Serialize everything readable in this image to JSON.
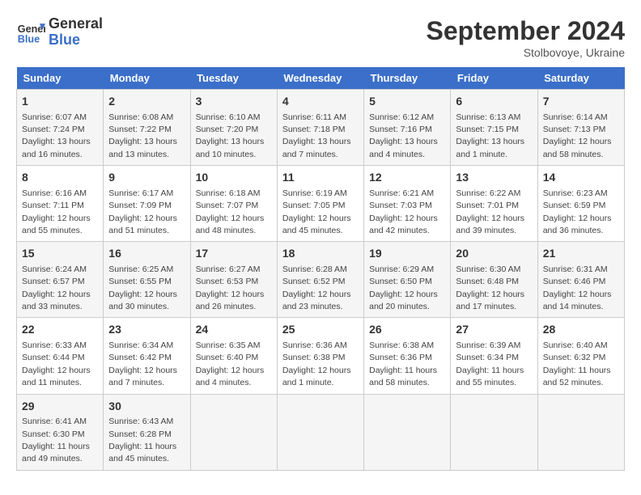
{
  "logo": {
    "line1": "General",
    "line2": "Blue"
  },
  "title": "September 2024",
  "subtitle": "Stolbovoye, Ukraine",
  "weekdays": [
    "Sunday",
    "Monday",
    "Tuesday",
    "Wednesday",
    "Thursday",
    "Friday",
    "Saturday"
  ],
  "weeks": [
    [
      {
        "day": "1",
        "sunrise": "Sunrise: 6:07 AM",
        "sunset": "Sunset: 7:24 PM",
        "daylight": "Daylight: 13 hours and 16 minutes."
      },
      {
        "day": "2",
        "sunrise": "Sunrise: 6:08 AM",
        "sunset": "Sunset: 7:22 PM",
        "daylight": "Daylight: 13 hours and 13 minutes."
      },
      {
        "day": "3",
        "sunrise": "Sunrise: 6:10 AM",
        "sunset": "Sunset: 7:20 PM",
        "daylight": "Daylight: 13 hours and 10 minutes."
      },
      {
        "day": "4",
        "sunrise": "Sunrise: 6:11 AM",
        "sunset": "Sunset: 7:18 PM",
        "daylight": "Daylight: 13 hours and 7 minutes."
      },
      {
        "day": "5",
        "sunrise": "Sunrise: 6:12 AM",
        "sunset": "Sunset: 7:16 PM",
        "daylight": "Daylight: 13 hours and 4 minutes."
      },
      {
        "day": "6",
        "sunrise": "Sunrise: 6:13 AM",
        "sunset": "Sunset: 7:15 PM",
        "daylight": "Daylight: 13 hours and 1 minute."
      },
      {
        "day": "7",
        "sunrise": "Sunrise: 6:14 AM",
        "sunset": "Sunset: 7:13 PM",
        "daylight": "Daylight: 12 hours and 58 minutes."
      }
    ],
    [
      {
        "day": "8",
        "sunrise": "Sunrise: 6:16 AM",
        "sunset": "Sunset: 7:11 PM",
        "daylight": "Daylight: 12 hours and 55 minutes."
      },
      {
        "day": "9",
        "sunrise": "Sunrise: 6:17 AM",
        "sunset": "Sunset: 7:09 PM",
        "daylight": "Daylight: 12 hours and 51 minutes."
      },
      {
        "day": "10",
        "sunrise": "Sunrise: 6:18 AM",
        "sunset": "Sunset: 7:07 PM",
        "daylight": "Daylight: 12 hours and 48 minutes."
      },
      {
        "day": "11",
        "sunrise": "Sunrise: 6:19 AM",
        "sunset": "Sunset: 7:05 PM",
        "daylight": "Daylight: 12 hours and 45 minutes."
      },
      {
        "day": "12",
        "sunrise": "Sunrise: 6:21 AM",
        "sunset": "Sunset: 7:03 PM",
        "daylight": "Daylight: 12 hours and 42 minutes."
      },
      {
        "day": "13",
        "sunrise": "Sunrise: 6:22 AM",
        "sunset": "Sunset: 7:01 PM",
        "daylight": "Daylight: 12 hours and 39 minutes."
      },
      {
        "day": "14",
        "sunrise": "Sunrise: 6:23 AM",
        "sunset": "Sunset: 6:59 PM",
        "daylight": "Daylight: 12 hours and 36 minutes."
      }
    ],
    [
      {
        "day": "15",
        "sunrise": "Sunrise: 6:24 AM",
        "sunset": "Sunset: 6:57 PM",
        "daylight": "Daylight: 12 hours and 33 minutes."
      },
      {
        "day": "16",
        "sunrise": "Sunrise: 6:25 AM",
        "sunset": "Sunset: 6:55 PM",
        "daylight": "Daylight: 12 hours and 30 minutes."
      },
      {
        "day": "17",
        "sunrise": "Sunrise: 6:27 AM",
        "sunset": "Sunset: 6:53 PM",
        "daylight": "Daylight: 12 hours and 26 minutes."
      },
      {
        "day": "18",
        "sunrise": "Sunrise: 6:28 AM",
        "sunset": "Sunset: 6:52 PM",
        "daylight": "Daylight: 12 hours and 23 minutes."
      },
      {
        "day": "19",
        "sunrise": "Sunrise: 6:29 AM",
        "sunset": "Sunset: 6:50 PM",
        "daylight": "Daylight: 12 hours and 20 minutes."
      },
      {
        "day": "20",
        "sunrise": "Sunrise: 6:30 AM",
        "sunset": "Sunset: 6:48 PM",
        "daylight": "Daylight: 12 hours and 17 minutes."
      },
      {
        "day": "21",
        "sunrise": "Sunrise: 6:31 AM",
        "sunset": "Sunset: 6:46 PM",
        "daylight": "Daylight: 12 hours and 14 minutes."
      }
    ],
    [
      {
        "day": "22",
        "sunrise": "Sunrise: 6:33 AM",
        "sunset": "Sunset: 6:44 PM",
        "daylight": "Daylight: 12 hours and 11 minutes."
      },
      {
        "day": "23",
        "sunrise": "Sunrise: 6:34 AM",
        "sunset": "Sunset: 6:42 PM",
        "daylight": "Daylight: 12 hours and 7 minutes."
      },
      {
        "day": "24",
        "sunrise": "Sunrise: 6:35 AM",
        "sunset": "Sunset: 6:40 PM",
        "daylight": "Daylight: 12 hours and 4 minutes."
      },
      {
        "day": "25",
        "sunrise": "Sunrise: 6:36 AM",
        "sunset": "Sunset: 6:38 PM",
        "daylight": "Daylight: 12 hours and 1 minute."
      },
      {
        "day": "26",
        "sunrise": "Sunrise: 6:38 AM",
        "sunset": "Sunset: 6:36 PM",
        "daylight": "Daylight: 11 hours and 58 minutes."
      },
      {
        "day": "27",
        "sunrise": "Sunrise: 6:39 AM",
        "sunset": "Sunset: 6:34 PM",
        "daylight": "Daylight: 11 hours and 55 minutes."
      },
      {
        "day": "28",
        "sunrise": "Sunrise: 6:40 AM",
        "sunset": "Sunset: 6:32 PM",
        "daylight": "Daylight: 11 hours and 52 minutes."
      }
    ],
    [
      {
        "day": "29",
        "sunrise": "Sunrise: 6:41 AM",
        "sunset": "Sunset: 6:30 PM",
        "daylight": "Daylight: 11 hours and 49 minutes."
      },
      {
        "day": "30",
        "sunrise": "Sunrise: 6:43 AM",
        "sunset": "Sunset: 6:28 PM",
        "daylight": "Daylight: 11 hours and 45 minutes."
      },
      null,
      null,
      null,
      null,
      null
    ]
  ]
}
